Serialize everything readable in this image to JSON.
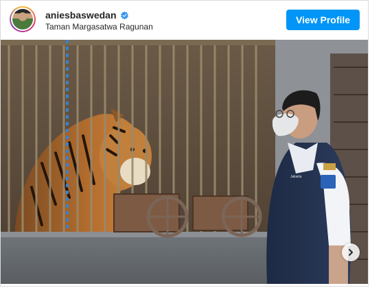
{
  "header": {
    "username": "aniesbaswedan",
    "location": "Taman Margasatwa Ragunan",
    "view_profile_label": "View Profile"
  },
  "post": {
    "image_description": "",
    "carousel_next_icon": "chevron-right-icon",
    "uniform_label": "Jakarta"
  },
  "colors": {
    "button_bg": "#0095f6",
    "verified_badge": "#3897f0",
    "text": "#262626"
  }
}
